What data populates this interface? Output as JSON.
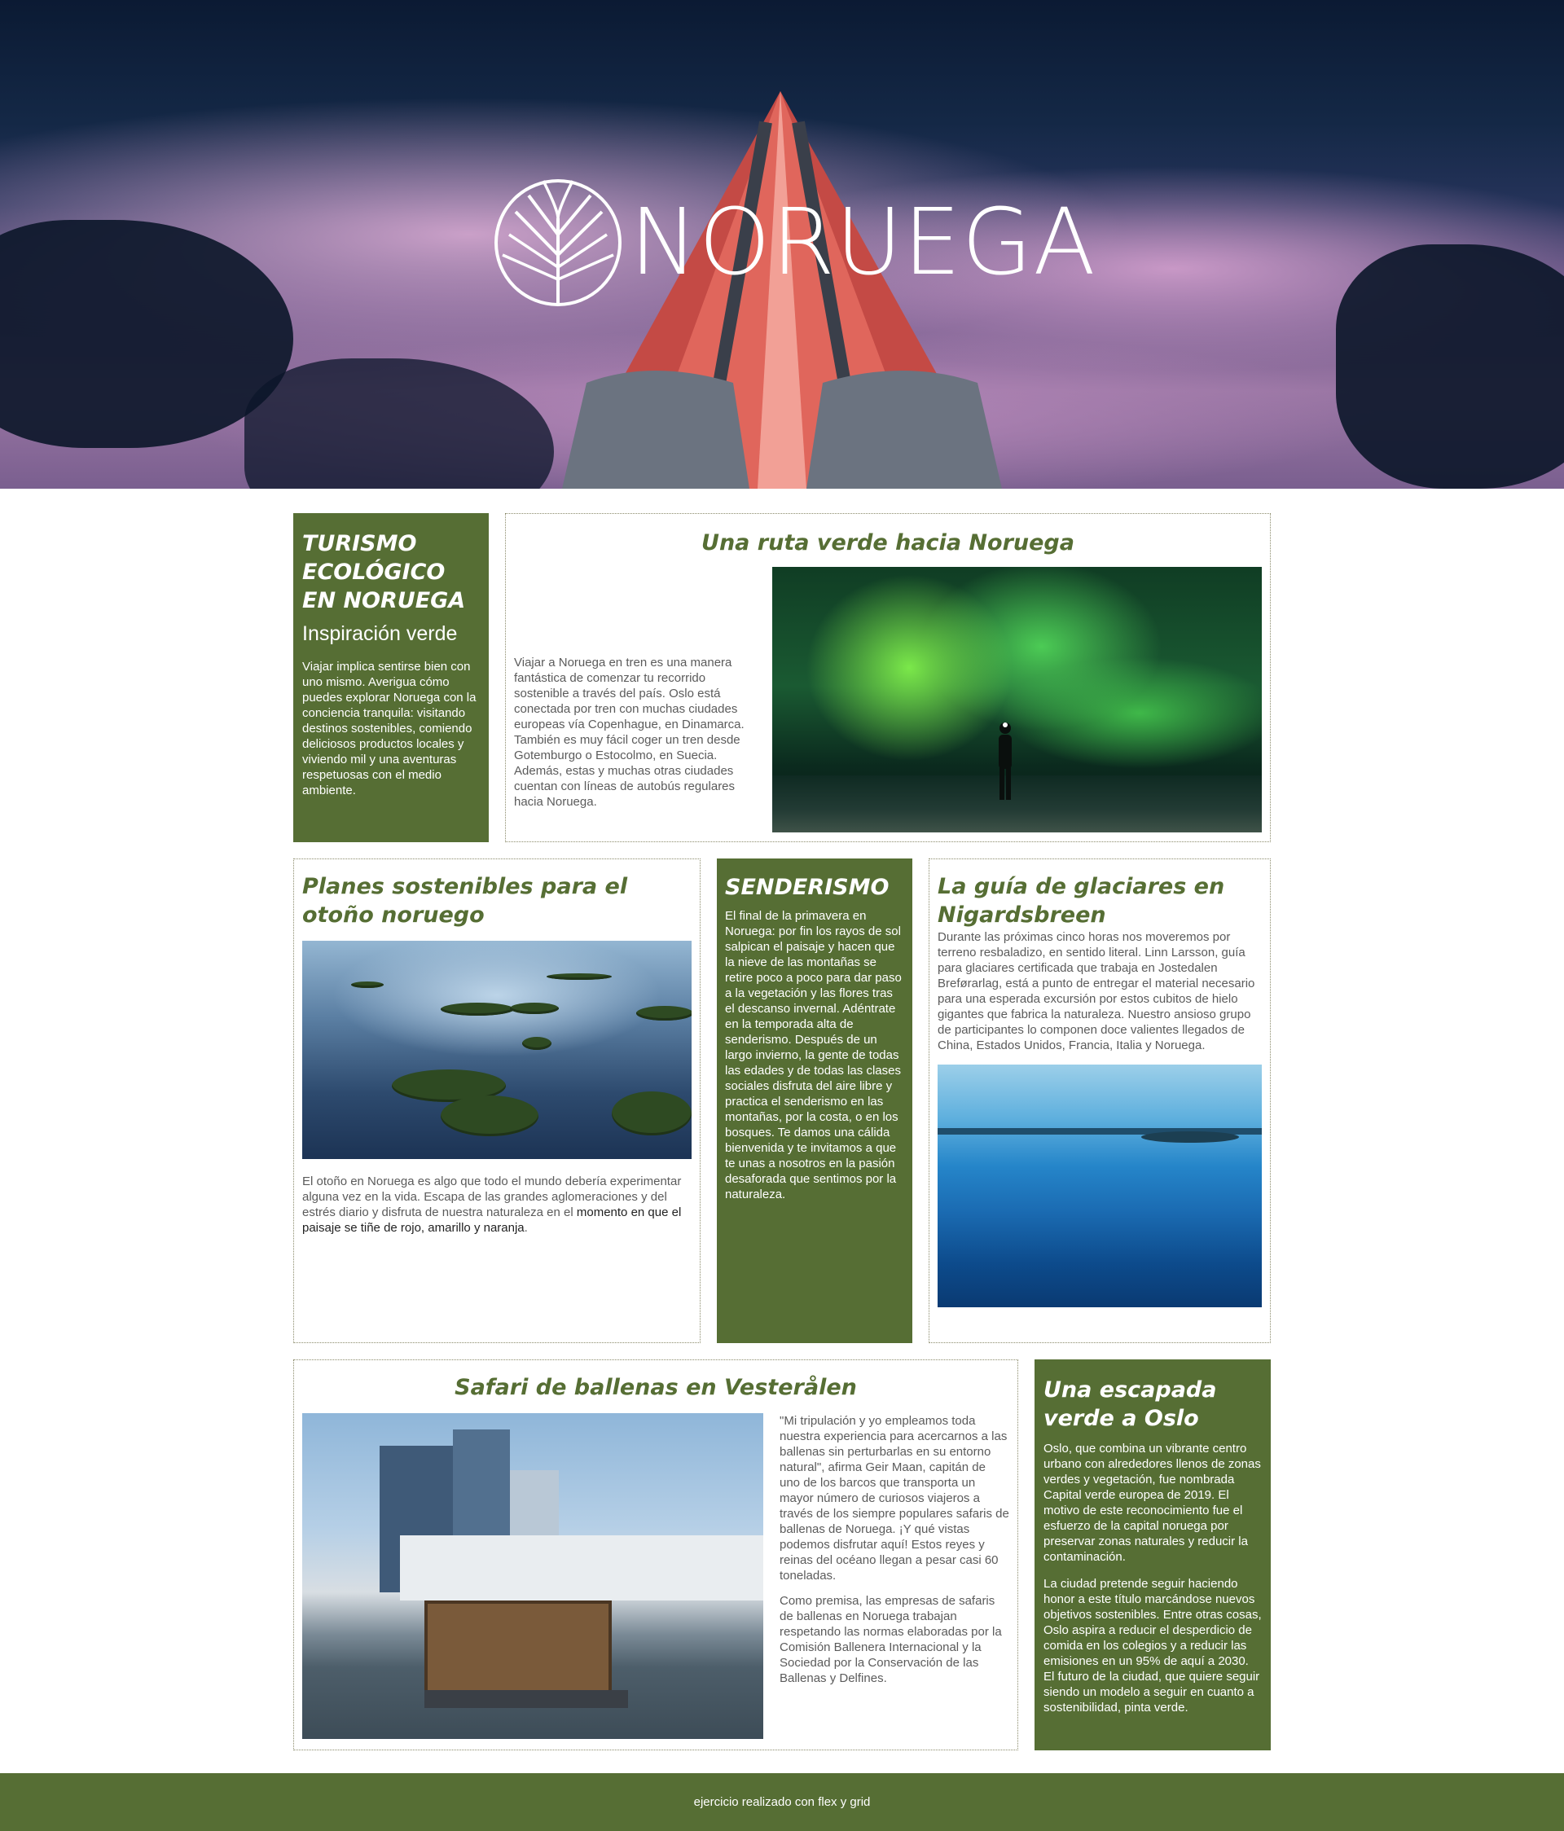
{
  "hero": {
    "logo_text": "NORUEGA"
  },
  "eco": {
    "title": "TURISMO ECOLÓGICO EN NORUEGA",
    "subtitle": "Inspiración verde",
    "text": "Viajar implica sentirse bien con uno mismo. Averigua cómo puedes explorar Noruega con la conciencia tranquila: visitando destinos sostenibles, comiendo deliciosos productos locales y viviendo mil y una aventuras respetuosas con el medio ambiente."
  },
  "ruta": {
    "title": "Una ruta verde hacia Noruega",
    "text": "Viajar a Noruega en tren es una manera fantástica de comenzar tu recorrido sostenible a través del país. Oslo está conectada por tren con muchas ciudades europeas vía Copenhague, en Dinamarca. También es muy fácil coger un tren desde Gotemburgo o Estocolmo, en Suecia. Además, estas y muchas otras ciudades cuentan con líneas de autobús regulares hacia Noruega."
  },
  "planes": {
    "title": "Planes sostenibles para el otoño noruego",
    "text_1": "El otoño en Noruega es algo que todo el mundo debería experimentar alguna vez en la vida. Escapa de las grandes aglomeraciones y del estrés diario y disfruta de nuestra naturaleza en el",
    "text_link": "momento en que el paisaje se tiñe de rojo, amarillo y naranja",
    "text_end": "."
  },
  "senderismo": {
    "title": "SENDERISMO",
    "text": "El final de la primavera en Noruega: por fin los rayos de sol salpican el paisaje y hacen que la nieve de las montañas se retire poco a poco para dar paso a la vegetación y las flores tras el descanso invernal. Adéntrate en la temporada alta de senderismo. Después de un largo invierno, la gente de todas las edades y de todas las clases sociales disfruta del aire libre y practica el senderismo en las montañas, por la costa, o en los bosques. Te damos una cálida bienvenida y te invitamos a que te unas a nosotros en la pasión desaforada que sentimos por la naturaleza."
  },
  "glaciares": {
    "title": "La guía de glaciares en Nigardsbreen",
    "text": "Durante las próximas cinco horas nos moveremos por terreno resbaladizo, en sentido literal. Linn Larsson, guía para glaciares certificada que trabaja en Jostedalen Breførarlag, está a punto de entregar el material necesario para una esperada excursión por estos cubitos de hielo gigantes que fabrica la naturaleza. Nuestro ansioso grupo de participantes lo componen doce valientes llegados de China, Estados Unidos, Francia, Italia y Noruega."
  },
  "safari": {
    "title": "Safari de ballenas en Vesterålen",
    "text_1": "\"Mi tripulación y yo empleamos toda nuestra experiencia para acercarnos a las ballenas sin perturbarlas en su entorno natural\", afirma Geir Maan, capitán de uno de los barcos que transporta un mayor número de curiosos viajeros a través de los siempre populares safaris de ballenas de Noruega. ¡Y qué vistas podemos disfrutar aquí! Estos reyes y reinas del océano llegan a pesar casi 60 toneladas.",
    "text_2": "Como premisa, las empresas de safaris de ballenas en Noruega trabajan respetando las normas elaboradas por la Comisión Ballenera Internacional y la Sociedad por la Conservación de las Ballenas y Delfines."
  },
  "oslo": {
    "title": "Una escapada verde a Oslo",
    "text_1": "Oslo, que combina un vibrante centro urbano con alrededores llenos de zonas verdes y vegetación, fue nombrada Capital verde europea de 2019. El motivo de este reconocimiento fue el esfuerzo de la capital noruega por preservar zonas naturales y reducir la contaminación.",
    "text_2": "La ciudad pretende seguir haciendo honor a este título marcándose nuevos objetivos sostenibles. Entre otras cosas, Oslo aspira a reducir el desperdicio de comida en los colegios y a reducir las emisiones en un 95% de aquí a 2030. El futuro de la ciudad, que quiere seguir siendo un modelo a seguir en cuanto a sostenibilidad, pinta verde."
  },
  "footer": {
    "text": "ejercicio realizado con flex y grid"
  },
  "colors": {
    "brand_green": "#566e34",
    "text_gray": "#5b5b5b",
    "white": "#ffffff"
  },
  "icons": {
    "logo": "leaf-circle-logo-icon"
  }
}
